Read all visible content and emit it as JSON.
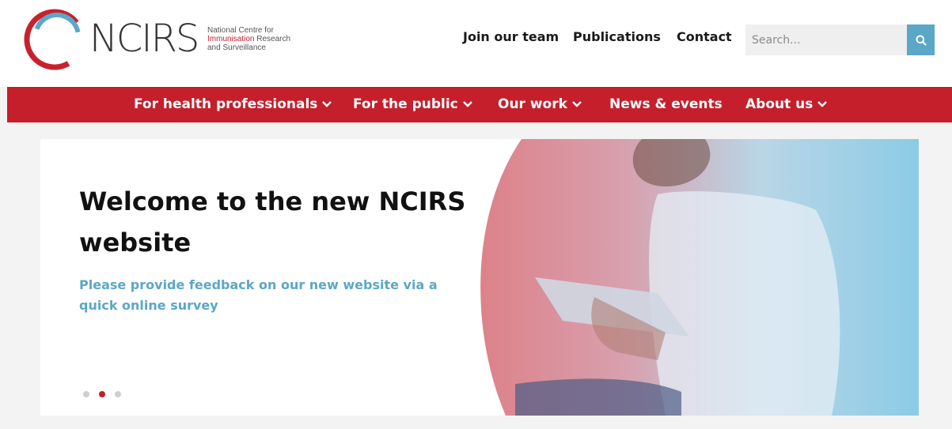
{
  "logo": {
    "wordmark": "NCIRS",
    "tagline_line1": "National Centre for",
    "tagline_line2_red": "Immunisation",
    "tagline_line2_rest": " Research",
    "tagline_line3": "and Surveillance",
    "ring_colors": [
      "#c8212e",
      "#5ba7c8"
    ]
  },
  "header_links": [
    "Join our team",
    "Publications",
    "Contact"
  ],
  "search": {
    "placeholder": "Search...",
    "button_icon": "search-icon"
  },
  "nav": [
    {
      "label": "For health professionals",
      "dropdown": true
    },
    {
      "label": "For the public",
      "dropdown": true
    },
    {
      "label": "Our work",
      "dropdown": true
    },
    {
      "label": "News & events",
      "dropdown": false
    },
    {
      "label": "About us",
      "dropdown": true
    }
  ],
  "hero": {
    "title": "Welcome to the new NCIRS website",
    "subtitle": "Please provide feedback on our new website via a quick online survey",
    "carousel_active_index": 1,
    "carousel_count": 3
  },
  "colors": {
    "brand_red": "#c41f2b",
    "accent_blue": "#5ba7c8"
  }
}
